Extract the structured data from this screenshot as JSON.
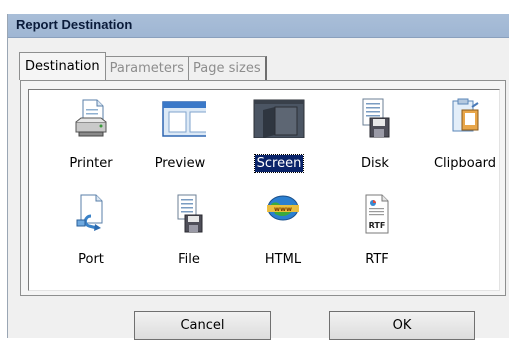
{
  "dialog": {
    "title": "Report Destination"
  },
  "tabs": [
    {
      "label": "Destination",
      "active": true
    },
    {
      "label": "Parameters",
      "active": false
    },
    {
      "label": "Page sizes",
      "active": false
    }
  ],
  "destinations": [
    {
      "label": "Printer",
      "icon": "printer-icon",
      "selected": false
    },
    {
      "label": "Preview",
      "icon": "preview-icon",
      "selected": false
    },
    {
      "label": "Screen",
      "icon": "screen-icon",
      "selected": true
    },
    {
      "label": "Disk",
      "icon": "disk-icon",
      "selected": false
    },
    {
      "label": "Clipboard",
      "icon": "clipboard-icon",
      "selected": false
    },
    {
      "label": "Port",
      "icon": "port-icon",
      "selected": false
    },
    {
      "label": "File",
      "icon": "file-icon",
      "selected": false
    },
    {
      "label": "HTML",
      "icon": "html-globe-icon",
      "selected": false
    },
    {
      "label": "RTF",
      "icon": "rtf-document-icon",
      "selected": false,
      "icon_text": "RTF"
    }
  ],
  "buttons": {
    "cancel": "Cancel",
    "ok": "OK"
  },
  "colors": {
    "titlebar": "#a9bed8",
    "selection": "#0a246a"
  }
}
